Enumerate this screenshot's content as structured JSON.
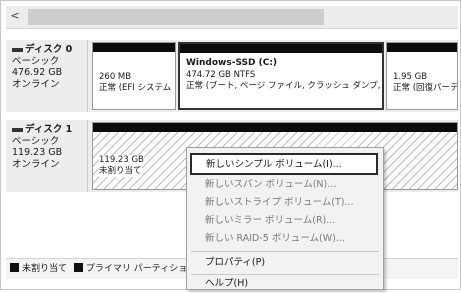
{
  "scrollbar": {
    "left_arrow": "<"
  },
  "disk0": {
    "name": "ディスク 0",
    "type": "ベーシック",
    "size": "476.92 GB",
    "status": "オンライン",
    "partitions": [
      {
        "size": "260 MB",
        "status": "正常 (EFI システム"
      },
      {
        "title": "Windows-SSD  (C:)",
        "size": "474.72 GB NTFS",
        "status": "正常 (ブート, ページ ファイル, クラッシュ ダンプ, ベー"
      },
      {
        "size": "1.95 GB",
        "status": "正常 (回復パーティシ"
      }
    ]
  },
  "disk1": {
    "name": "ディスク 1",
    "type": "ベーシック",
    "size": "119.23 GB",
    "status": "オンライン",
    "unallocated": {
      "size": "119.23 GB",
      "status": "未割り当て"
    }
  },
  "legend": {
    "unallocated": "未割り当て",
    "primary": "プライマリ パーティション"
  },
  "context_menu": {
    "new_simple": "新しいシンプル ボリューム(I)...",
    "new_spanned": "新しいスパン ボリューム(N)...",
    "new_striped": "新しいストライプ ボリューム(T)...",
    "new_mirror": "新しいミラー ボリューム(R)...",
    "new_raid5": "新しい RAID-5 ボリューム(W)...",
    "properties": "プロパティ(P)",
    "help": "ヘルプ(H)"
  }
}
